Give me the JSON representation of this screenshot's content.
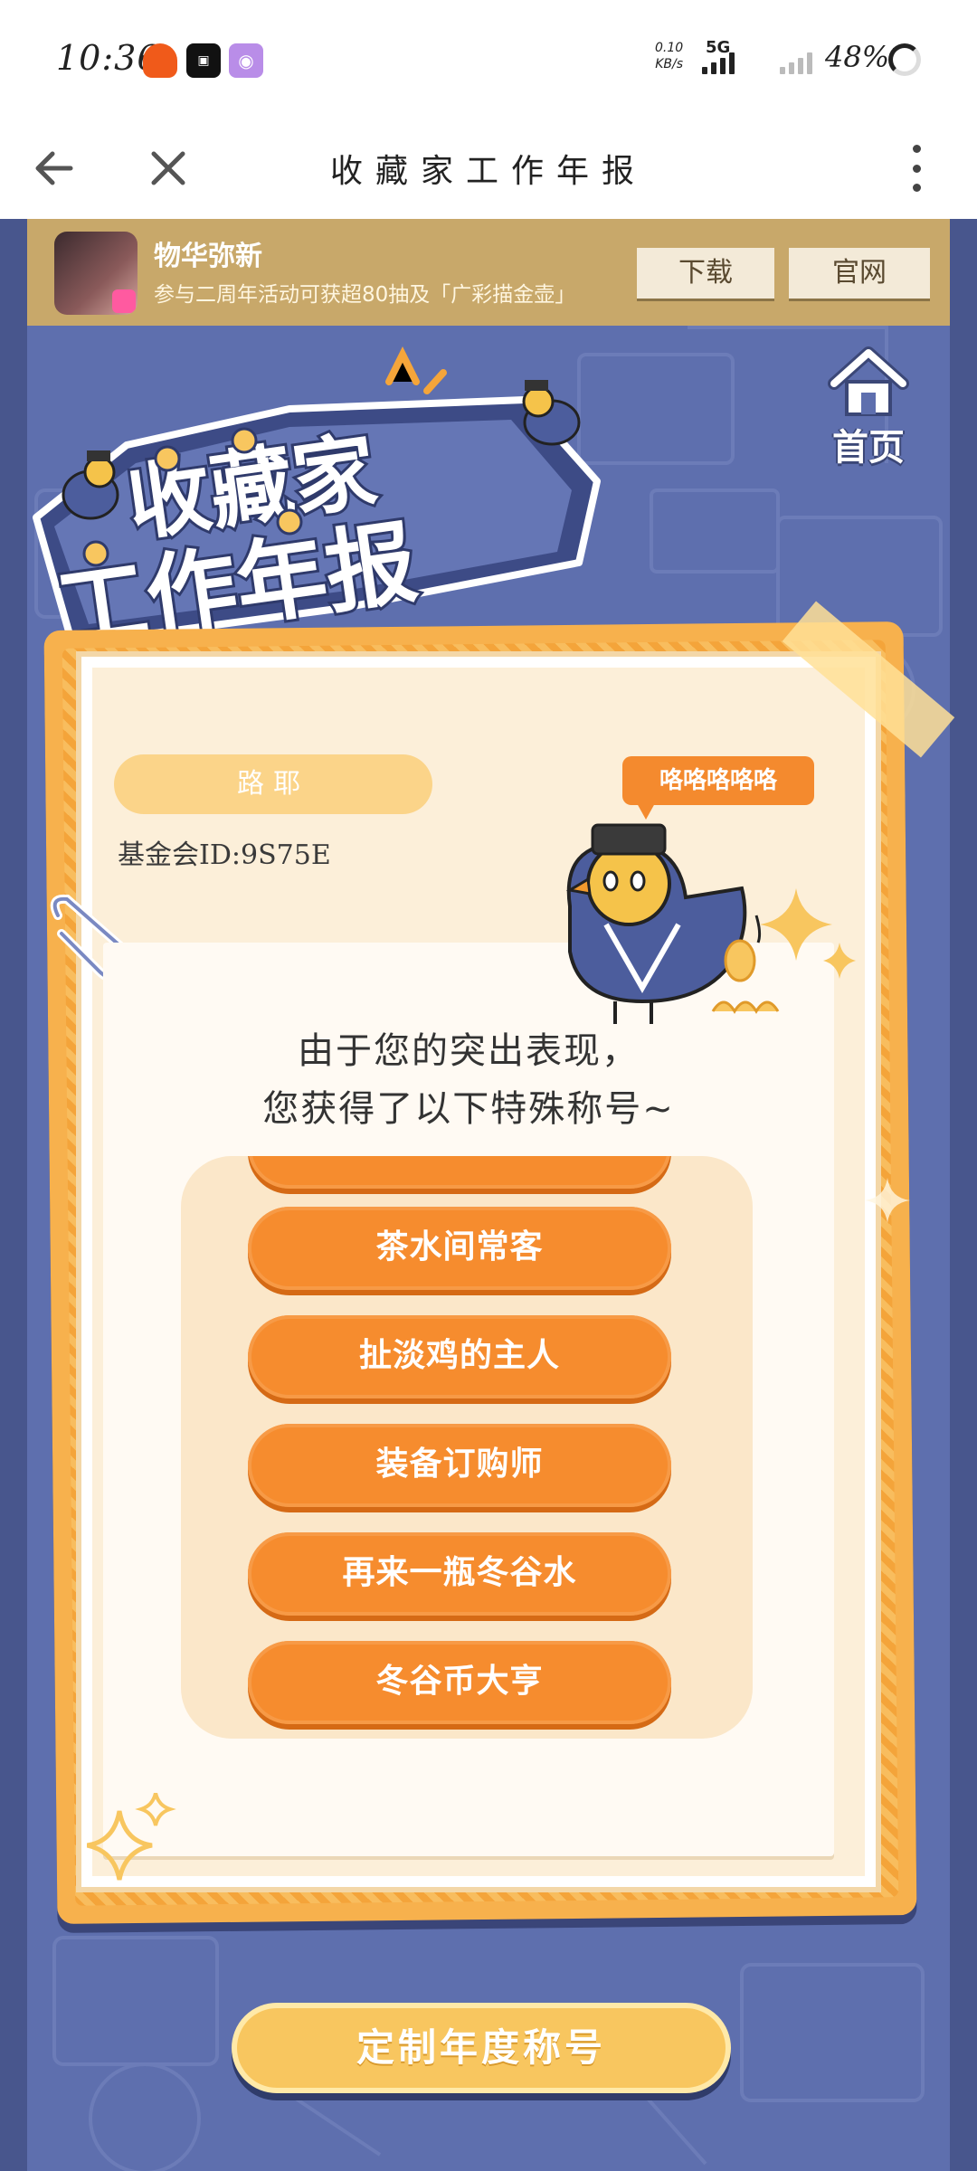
{
  "status_bar": {
    "time": "10:36",
    "net_speed_value": "0.10",
    "net_speed_unit": "KB/s",
    "network": "5G",
    "battery": "48%"
  },
  "nav": {
    "title": "收藏家工作年报"
  },
  "ad": {
    "app_name": "物华弥新",
    "description": "参与二周年活动可获超80抽及「广彩描金壶」",
    "download_label": "下载",
    "website_label": "官网"
  },
  "home_label": "首页",
  "logo_text": {
    "line1": "收藏家",
    "line2": "工作年报"
  },
  "profile": {
    "name": "路耶",
    "fund_id": "基金会ID:9S75E"
  },
  "speech_bubble": "咯咯咯咯咯",
  "message": {
    "line1": "由于您的突出表现，",
    "line2": "您获得了以下特殊称号~"
  },
  "titles": [
    "",
    "茶水间常客",
    "扯淡鸡的主人",
    "装备订购师",
    "再来一瓶冬谷水",
    "冬谷币大亨"
  ],
  "cta_label": "定制年度称号",
  "colors": {
    "background": "#5e6fae",
    "card_orange": "#f7b14d",
    "title_button": "#f68c2e",
    "ad_banner": "#c8a86a"
  }
}
